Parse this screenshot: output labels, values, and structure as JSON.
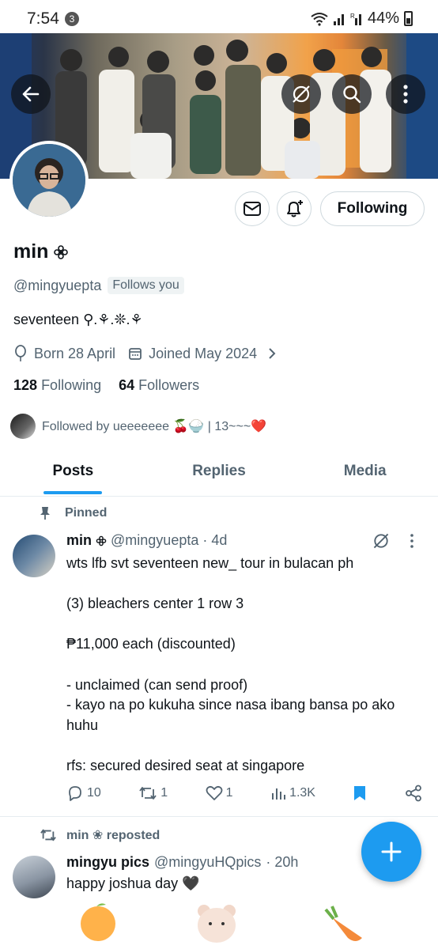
{
  "status_bar": {
    "time": "7:54",
    "notif_count": "3",
    "battery": "44%"
  },
  "profile": {
    "name": "min",
    "handle": "@mingyuepta",
    "follows_you": "Follows you",
    "bio": "seventeen ⚲.⚘.❊.⚘",
    "born": "Born 28 April",
    "joined": "Joined May 2024",
    "following_count": "128",
    "following_label": "Following",
    "followers_count": "64",
    "followers_label": "Followers",
    "followed_by": "Followed by ueeeeeee 🍒🍚 | 13~~~❤️",
    "following_button": "Following"
  },
  "tabs": [
    "Posts",
    "Replies",
    "Media"
  ],
  "pinned_post": {
    "pinned_label": "Pinned",
    "author": "min",
    "handle": "@mingyuepta",
    "time": "· 4d",
    "text": "wts lfb svt seventeen new_ tour in bulacan ph\n\n(3) bleachers center 1 row 3\n\n₱11,000 each (discounted)\n\n-  unclaimed (can send proof)\n- kayo na po kukuha since nasa ibang bansa po ako huhu\n\nrfs: secured desired seat at singapore",
    "replies": "10",
    "reposts": "1",
    "likes": "1",
    "views": "1.3K"
  },
  "repost": {
    "repost_label": "min ❀ reposted",
    "author": "mingyu pics",
    "handle": "@mingyuHQpics",
    "time": "· 20h",
    "text": "happy joshua day 🖤"
  },
  "colors": {
    "accent": "#1d9bf0",
    "text": "#0f1419",
    "muted": "#536471",
    "border": "#cfd9de"
  }
}
